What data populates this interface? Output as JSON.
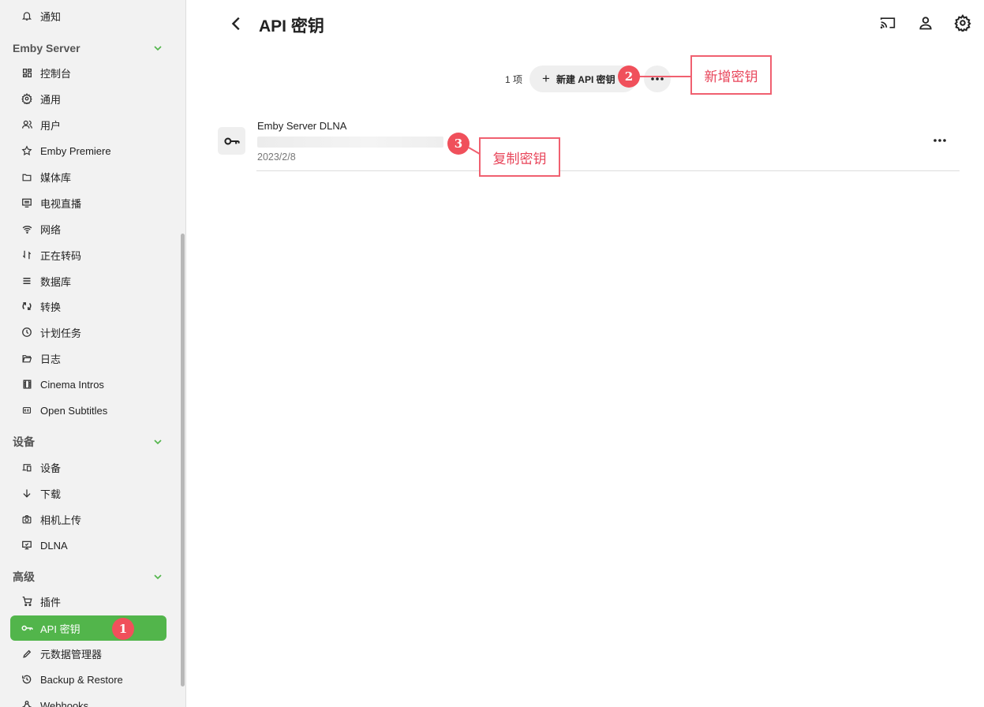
{
  "sidebar": {
    "items": {
      "notify": "通知",
      "dashboard": "控制台",
      "general": "通用",
      "users": "用户",
      "premiere": "Emby Premiere",
      "library": "媒体库",
      "livetv": "电视直播",
      "network": "网络",
      "transcoding": "正在转码",
      "database": "数据库",
      "conversions": "转换",
      "scheduled": "计划任务",
      "logs": "日志",
      "cinema": "Cinema Intros",
      "subtitles": "Open Subtitles",
      "devices": "设备",
      "downloads": "下载",
      "camera": "相机上传",
      "dlna": "DLNA",
      "plugins": "插件",
      "apikeys": "API 密钥",
      "metadata": "元数据管理器",
      "backup": "Backup & Restore",
      "webhooks": "Webhooks"
    },
    "sections": {
      "server": "Emby Server",
      "devices": "设备",
      "advanced": "高级"
    },
    "accent": "#52b54b"
  },
  "header": {
    "title": "API 密钥"
  },
  "toolbar": {
    "count": "1 项",
    "new_label": "新建 API 密钥"
  },
  "keys": [
    {
      "name": "Emby Server DLNA",
      "date": "2023/2/8"
    }
  ],
  "annotations": {
    "badge1": "1",
    "badge2": "2",
    "badge3": "3",
    "callout2": "新增密钥",
    "callout3": "复制密钥",
    "color": "#f0505b"
  }
}
